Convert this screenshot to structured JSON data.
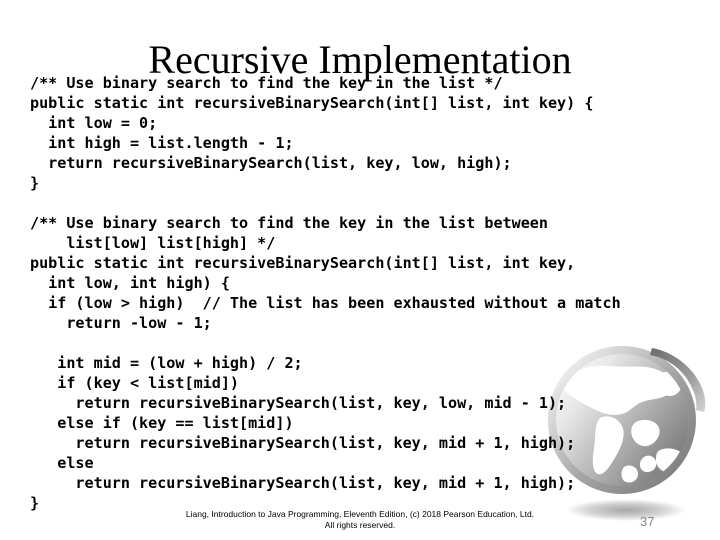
{
  "slide": {
    "title": "Recursive Implementation",
    "page_number": "37",
    "background_color": "#ffffff",
    "text_color": "#000000",
    "page_number_color": "#8a8a8a"
  },
  "code": {
    "language": "java",
    "lines": [
      "/** Use binary search to find the key in the list */",
      "public static int recursiveBinarySearch(int[] list, int key) {",
      "  int low = 0;",
      "  int high = list.length - 1;",
      "  return recursiveBinarySearch(list, key, low, high);",
      "}",
      "",
      "/** Use binary search to find the key in the list between",
      "    list[low] list[high] */",
      "public static int recursiveBinarySearch(int[] list, int key,",
      "  int low, int high) {",
      "  if (low > high)  // The list has been exhausted without a match",
      "    return -low - 1;",
      "",
      "   int mid = (low + high) / 2;",
      "   if (key < list[mid])",
      "     return recursiveBinarySearch(list, key, low, mid - 1);",
      "   else if (key == list[mid])",
      "     return recursiveBinarySearch(list, key, mid + 1, high);",
      "   else",
      "     return recursiveBinarySearch(list, key, mid + 1, high);",
      "}"
    ]
  },
  "footer": {
    "line1": "Liang, Introduction to Java Programming, Eleventh Edition, (c) 2018 Pearson Education, Ltd.",
    "line2": "All rights reserved."
  },
  "graphics": {
    "globe": {
      "name": "globe-watermark",
      "ring_color": "#9a9a9a",
      "sphere_color": "#8d8d8d",
      "land_color": "#ffffff",
      "shadow_color": "#b5b5b5"
    }
  }
}
